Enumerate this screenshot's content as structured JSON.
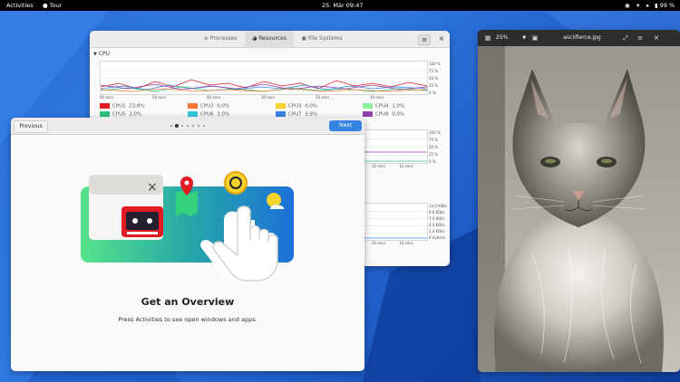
{
  "topbar": {
    "activities": "Activities",
    "app_name": "Tour",
    "clock": "25. Mär  09:47",
    "battery": "99 %"
  },
  "sysmon": {
    "tabs": [
      "Processes",
      "Resources",
      "File Systems"
    ],
    "active_tab": "Resources",
    "section_cpu": "CPU",
    "time_labels": [
      "60 secs",
      "50 secs",
      "40 secs",
      "30 secs",
      "20 secs",
      "10 secs"
    ],
    "pct_labels": [
      "100 %",
      "75 %",
      "50 %",
      "25 %",
      "0 %"
    ],
    "net_labels": [
      "14.0 KiB/s",
      "9.8 KiB/s",
      "7.0 KiB/s",
      "4.2 KiB/s",
      "1.4 KiB/s",
      "0 bytes/s"
    ],
    "cpus": [
      {
        "name": "CPU1",
        "value": "23,8%",
        "color": "#e01b24"
      },
      {
        "name": "CPU2",
        "value": "0,0%",
        "color": "#f6793b"
      },
      {
        "name": "CPU3",
        "value": "0,0%",
        "color": "#f6d32d"
      },
      {
        "name": "CPU4",
        "value": "1,0%",
        "color": "#8ff0a4"
      },
      {
        "name": "CPU5",
        "value": "2,0%",
        "color": "#2ec27e"
      },
      {
        "name": "CPU6",
        "value": "3,0%",
        "color": "#33c7de"
      },
      {
        "name": "CPU7",
        "value": "3,9%",
        "color": "#3584e4"
      },
      {
        "name": "CPU8",
        "value": "0,0%",
        "color": "#9141ac"
      }
    ]
  },
  "viewer": {
    "zoom": "25%",
    "filename": "asciifierce.jpg"
  },
  "tour": {
    "previous": "Previous",
    "next": "Next",
    "title": "Get an Overview",
    "description": "Press Activities to see open windows and apps.",
    "pages": 7,
    "current_page": 2
  }
}
